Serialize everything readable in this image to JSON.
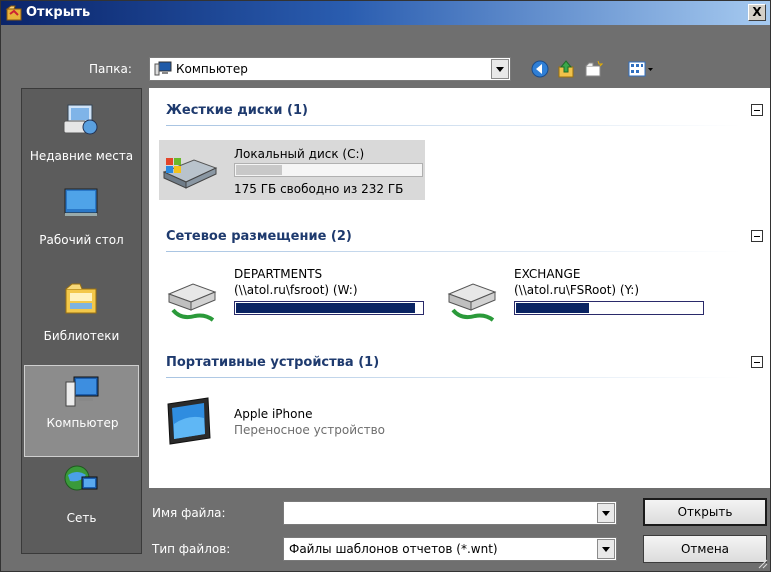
{
  "window": {
    "title": "Открыть",
    "close_label": "X"
  },
  "toolbar": {
    "folder_label": "Папка:",
    "folder_value": "Компьютер",
    "back_icon": "back-arrow-icon",
    "up_icon": "folder-up-icon",
    "new_folder_icon": "new-folder-icon",
    "views_icon": "view-menu-icon"
  },
  "places": [
    {
      "label": "Недавние места",
      "icon": "recent-places-icon"
    },
    {
      "label": "Рабочий стол",
      "icon": "desktop-icon"
    },
    {
      "label": "Библиотеки",
      "icon": "libraries-icon"
    },
    {
      "label": "Компьютер",
      "icon": "computer-icon",
      "active": true
    },
    {
      "label": "Сеть",
      "icon": "network-icon"
    }
  ],
  "groups": {
    "hard_disks": {
      "header": "Жесткие диски (1)",
      "items": [
        {
          "name": "Локальный диск (C:)",
          "free_text": "175 ГБ свободно из 232 ГБ",
          "used_fraction": 0.25,
          "icon": "local-disk-icon"
        }
      ]
    },
    "network": {
      "header": "Сетевое размещение (2)",
      "items": [
        {
          "name": "DEPARTMENTS",
          "path": "(\\\\atol.ru\\fsroot) (W:)",
          "used_fraction": 0.96,
          "icon": "network-drive-icon"
        },
        {
          "name": "EXCHANGE",
          "path": "(\\\\atol.ru\\FSRoot) (Y:)",
          "used_fraction": 0.39,
          "icon": "network-drive-icon"
        }
      ]
    },
    "portable": {
      "header": "Портативные устройства (1)",
      "items": [
        {
          "name": "Apple iPhone",
          "subtitle": "Переносное устройство",
          "icon": "portable-device-icon"
        }
      ]
    }
  },
  "footer": {
    "filename_label": "Имя файла:",
    "filename_value": "",
    "filetype_label": "Тип файлов:",
    "filetype_value": "Файлы шаблонов отчетов (*.wnt)",
    "open_button": "Открыть",
    "cancel_button": "Отмена"
  }
}
